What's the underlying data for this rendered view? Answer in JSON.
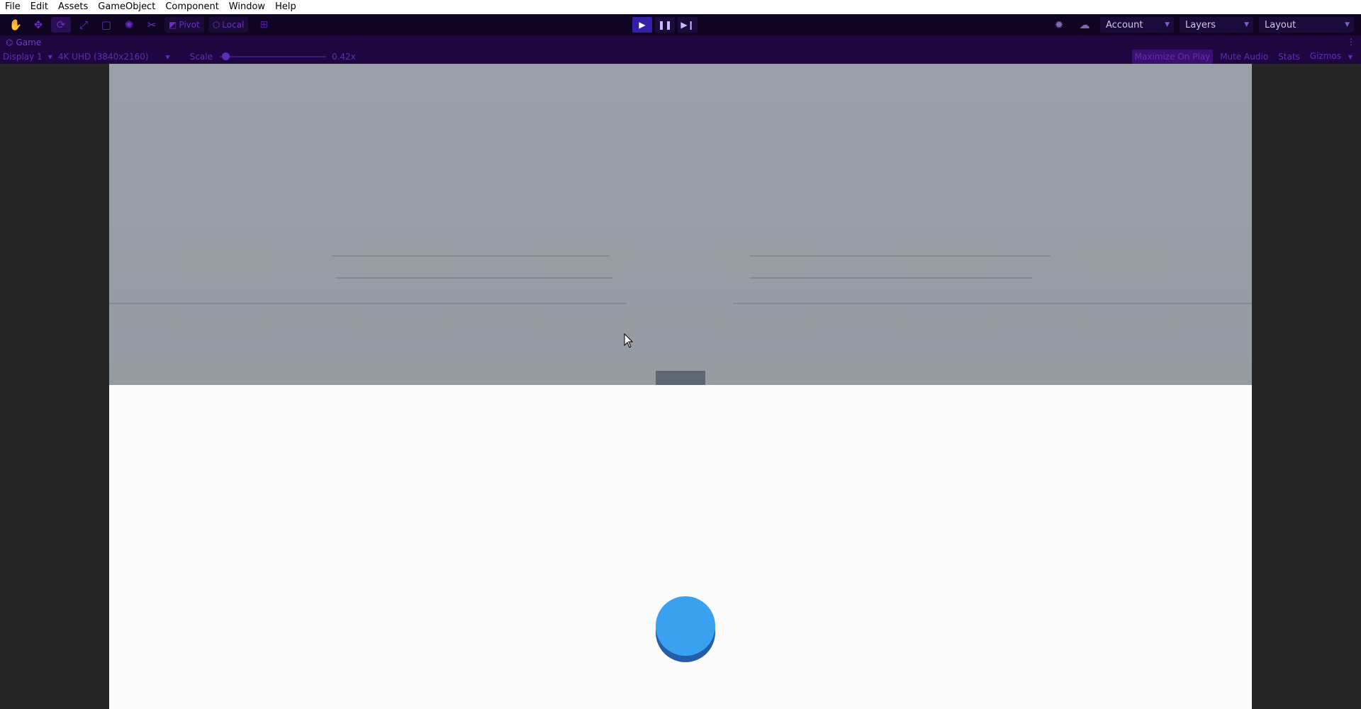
{
  "menu": [
    "File",
    "Edit",
    "Assets",
    "GameObject",
    "Component",
    "Window",
    "Help"
  ],
  "toolbar": {
    "tools": [
      {
        "icon": "hand-icon",
        "glyph": "✋"
      },
      {
        "icon": "move-icon",
        "glyph": "✥"
      },
      {
        "icon": "rotate-icon",
        "glyph": "⟳"
      },
      {
        "icon": "scale-icon",
        "glyph": "⤢"
      },
      {
        "icon": "rect-tool-icon",
        "glyph": "▢"
      },
      {
        "icon": "transform-icon",
        "glyph": "✺"
      },
      {
        "icon": "custom-tool-icon",
        "glyph": "✂"
      }
    ],
    "active_tool": 2,
    "pivot_label": "Pivot",
    "local_label": "Local",
    "account_label": "Account",
    "layers_label": "Layers",
    "layout_label": "Layout"
  },
  "tab": {
    "label": "Game",
    "icon": "game-controller-icon"
  },
  "gameview": {
    "display_label": "Display 1",
    "resolution_label": "4K UHD (3840x2160)",
    "scale_label": "Scale",
    "scale_value": "0.42x",
    "scale_fraction": 0.05,
    "maximize_label": "Maximize On Play",
    "mute_label": "Mute Audio",
    "stats_label": "Stats",
    "gizmos_label": "Gizmos"
  },
  "colors": {
    "toolbar_bg": "#0f0421",
    "accent": "#6a2fc9",
    "play_active": "#3420a8",
    "sky": "#9aa0a8",
    "ground": "#fbfbfb",
    "ball": "#3aa0f0",
    "ball_shadow": "#245ea6",
    "platform": "#5e6676"
  }
}
